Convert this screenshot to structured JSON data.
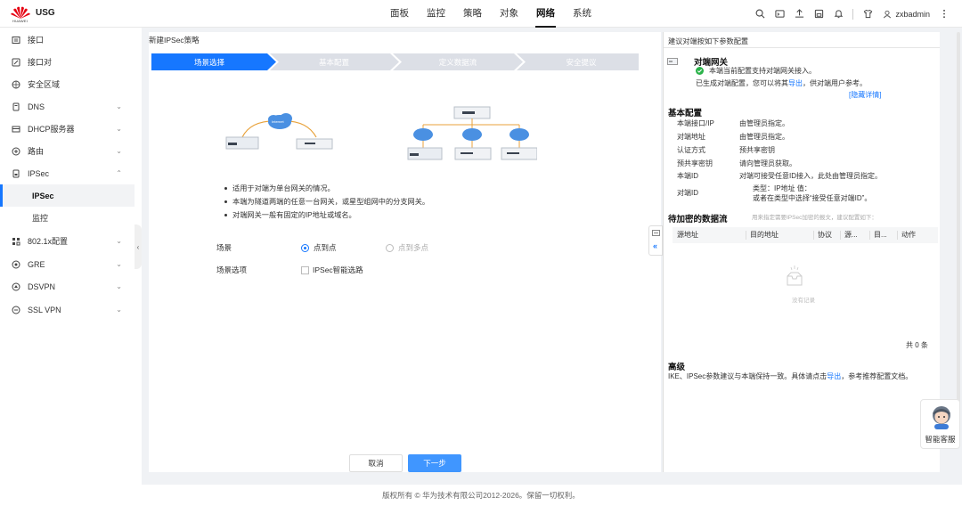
{
  "header": {
    "brand": "HUAWEI",
    "app_name": "USG",
    "nav": [
      "面板",
      "监控",
      "策略",
      "对象",
      "网络",
      "系统"
    ],
    "active_nav": "网络",
    "user": "zxbadmin"
  },
  "sidebar": {
    "items": [
      {
        "label": "接口",
        "icon": "interface-icon"
      },
      {
        "label": "接口对",
        "icon": "interface-pair-icon"
      },
      {
        "label": "安全区域",
        "icon": "security-zone-icon"
      },
      {
        "label": "DNS",
        "icon": "dns-icon"
      },
      {
        "label": "DHCP服务器",
        "icon": "dhcp-icon"
      },
      {
        "label": "路由",
        "icon": "route-icon"
      },
      {
        "label": "IPSec",
        "icon": "ipsec-icon"
      },
      {
        "label": "IPSec",
        "sub": true,
        "active": true
      },
      {
        "label": "监控",
        "sub": true
      },
      {
        "label": "802.1x配置",
        "icon": "dot1x-icon"
      },
      {
        "label": "GRE",
        "icon": "gre-icon"
      },
      {
        "label": "DSVPN",
        "icon": "dsvpn-icon"
      },
      {
        "label": "SSL VPN",
        "icon": "sslvpn-icon"
      }
    ]
  },
  "wizard": {
    "title": "新建IPSec策略",
    "steps": [
      "场景选择",
      "基本配置",
      "定义数据流",
      "安全提议"
    ],
    "internet_label": "Internet",
    "bullets": [
      "适用于对端为单台网关的情况。",
      "本端为隧道两端的任意一台网关，或星型组网中的分支网关。",
      "对端网关一般有固定的IP地址或域名。"
    ],
    "scene_label": "场景",
    "scene_options": [
      "点到点",
      "点到多点"
    ],
    "scene_selected": "点到点",
    "option_label": "场景选项",
    "option_checkbox": "IPSec智能选路",
    "cancel": "取消",
    "next": "下一步"
  },
  "right_panel": {
    "title": "建议对端按如下参数配置",
    "peer_heading": "对端网关",
    "peer_status": "本端当前配置支持对端网关接入。",
    "peer_export_pre": "已生成对端配置，您可以将其",
    "peer_export_link": "导出",
    "peer_export_post": "，供对端用户参考。",
    "hide_details": "[隐藏详情]",
    "basic_heading": "基本配置",
    "basic_rows": [
      {
        "k": "本端接口/IP",
        "v": "由管理员指定。"
      },
      {
        "k": "对端地址",
        "v": "由管理员指定。"
      },
      {
        "k": "认证方式",
        "v": "预共享密钥"
      },
      {
        "k": "预共享密钥",
        "v": "请向管理员获取。"
      },
      {
        "k": "本端ID",
        "v": "对端可接受任意ID接入，此处由管理员指定。"
      },
      {
        "k": "对端ID",
        "v": "类型：IP地址 值：",
        "v2": "或者在类型中选择“接受任意对端ID”。"
      }
    ],
    "flow_heading": "待加密的数据流",
    "flow_hint": "用来指定需要IPSec加密的报文，建议配置如下：",
    "table_cols": [
      "源地址",
      "目的地址",
      "协议",
      "源...",
      "目...",
      "动作"
    ],
    "empty_text": "没有记录",
    "total": "共 0 条",
    "advanced_heading": "高级",
    "advanced_pre": "IKE、IPSec参数建议与本端保持一致。具体请点击",
    "advanced_link": "导出",
    "advanced_post": "，参考推荐配置文档。"
  },
  "chat": {
    "label": "智能客服"
  },
  "footer": "版权所有 © 华为技术有限公司2012-2026。保留一切权利。",
  "colors": {
    "accent": "#1677ff",
    "step_active": "#1677ff",
    "step_inactive": "#dcdfe6"
  }
}
